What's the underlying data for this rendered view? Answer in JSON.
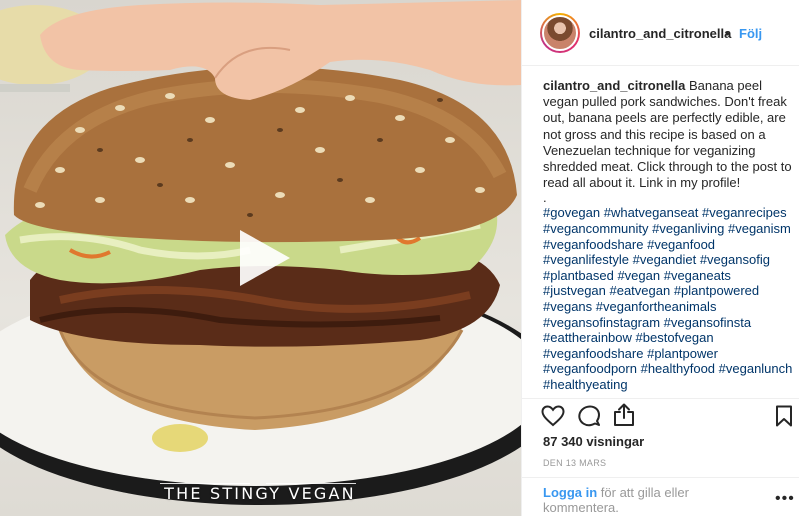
{
  "header": {
    "username": "cilantro_and_citronella",
    "separator": "•",
    "follow_label": "Följ"
  },
  "caption": {
    "username": "cilantro_and_citronella",
    "text": "Banana peel vegan pulled pork sandwiches. Don't freak out, banana peels are perfectly edible, are not gross and this recipe is based on a Venezuelan technique for veganizing shredded meat. Click through to the post to read all about it. Link in my profile!",
    "dot": ".",
    "hashtags": "#govegan #whatveganseat #veganrecipes #vegancommunity #veganliving #veganism #veganfoodshare #veganfood #veganlifestyle #vegandiet #vegansofig #plantbased #vegan #veganeats #justvegan #eatvegan #plantpowered #vegans #veganfortheanimals #vegansofinstagram #vegansofinsta #eattherainbow #bestofvegan #veganfoodshare #plantpower #veganfoodporn #healthyfood #veganlunch #healthyeating"
  },
  "stats": {
    "views": "87 340 visningar",
    "date": "DEN 13 MARS"
  },
  "footer": {
    "login_link": "Logga in",
    "login_rest": " för att gilla eller kommentera.",
    "more": "•••"
  },
  "media": {
    "watermark": "THE STINGY VEGAN"
  },
  "icons": {
    "play": "play-icon",
    "heart": "heart-icon",
    "comment": "comment-icon",
    "share": "share-icon",
    "bookmark": "bookmark-icon"
  }
}
